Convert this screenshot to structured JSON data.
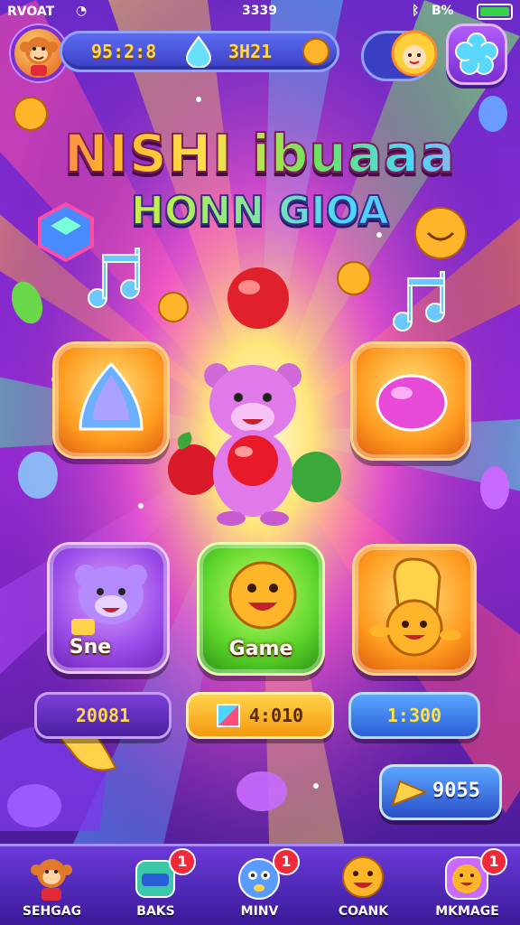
{
  "status_bar": {
    "carrier": "RVOAT",
    "time": "3339",
    "battery_text": "B%"
  },
  "top_bar": {
    "currency_left": "95:2:8",
    "currency_right": "3H21"
  },
  "title": {
    "line1": "NISHI ibuaaa",
    "line2": "HONN GIOA"
  },
  "tiles": [
    {
      "label": ""
    },
    {
      "label": ""
    },
    {
      "label": "Sne"
    },
    {
      "label": "Game"
    },
    {
      "label": ""
    }
  ],
  "stats": {
    "left": "20081",
    "center": "4:010",
    "right": "1:300"
  },
  "bonus": {
    "value": "9055"
  },
  "nav": [
    {
      "label": "SEHGAG",
      "badge": ""
    },
    {
      "label": "BAKS",
      "badge": "1"
    },
    {
      "label": "MINV",
      "badge": "1"
    },
    {
      "label": "COANK",
      "badge": ""
    },
    {
      "label": "MKMAGE",
      "badge": "1"
    }
  ],
  "colors": {
    "background": "#5b1fa8",
    "accent_yellow": "#ffd94a",
    "nav_bg": "#4b22b0"
  }
}
